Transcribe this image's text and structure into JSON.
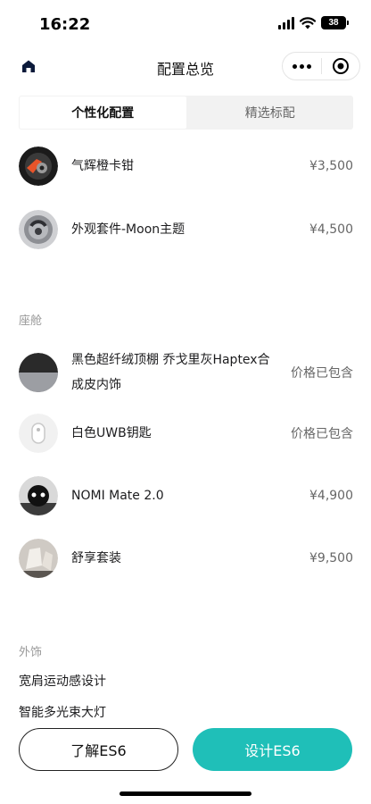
{
  "status_bar": {
    "time": "16:22",
    "battery": "38"
  },
  "nav": {
    "title": "配置总览",
    "home_icon": "home-icon",
    "more_icon": "more-dots-icon",
    "close_icon": "target-close-icon"
  },
  "tabs": [
    {
      "label": "个性化配置",
      "active": true
    },
    {
      "label": "精选标配",
      "active": false
    }
  ],
  "personalized_items": [
    {
      "name": "气辉橙卡钳",
      "price": "¥3,500"
    },
    {
      "name": "外观套件-Moon主题",
      "price": "¥4,500"
    }
  ],
  "cabin": {
    "label": "座舱",
    "items": [
      {
        "name": "黑色超纤绒顶棚 乔戈里灰Haptex合成皮内饰",
        "price": "价格已包含"
      },
      {
        "name": "白色UWB钥匙",
        "price": "价格已包含"
      },
      {
        "name": "NOMI Mate 2.0",
        "price": "¥4,900"
      },
      {
        "name": "舒享套装",
        "price": "¥9,500"
      }
    ]
  },
  "exterior": {
    "label": "外饰",
    "items": [
      {
        "name": "宽肩运动感设计"
      },
      {
        "name": "智能多光束大灯"
      }
    ]
  },
  "bottom": {
    "learn_label": "了解ES6",
    "design_label": "设计ES6",
    "accent": "#1fbfb8"
  }
}
